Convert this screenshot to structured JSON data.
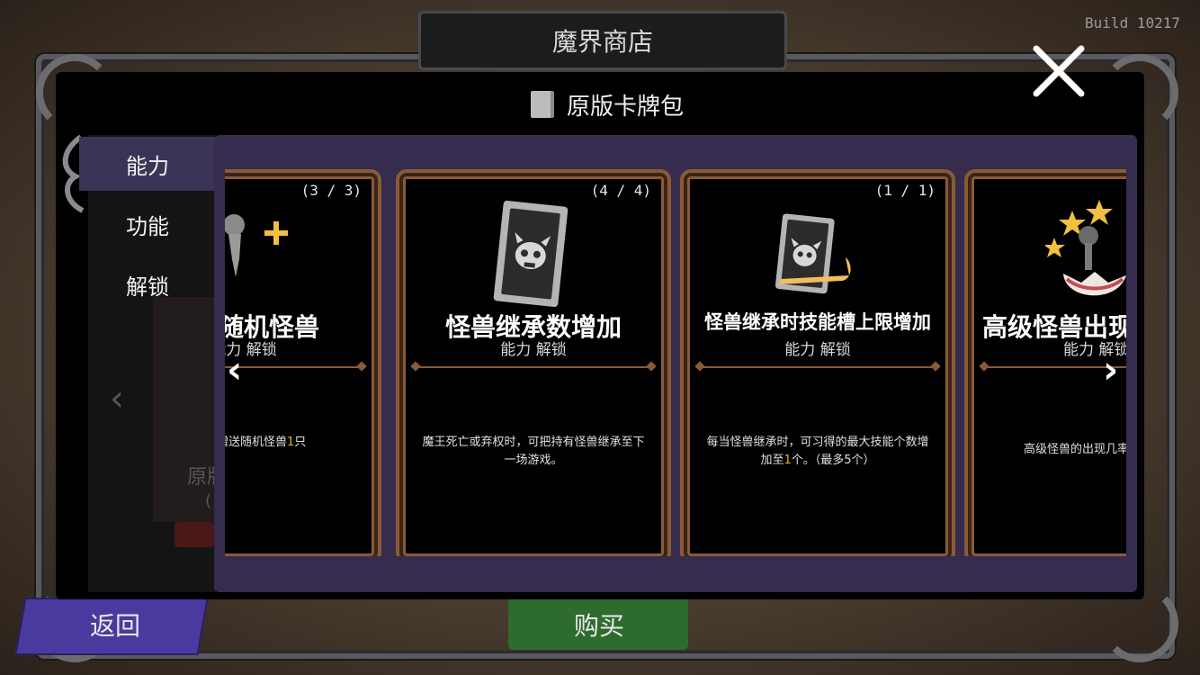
{
  "header": {
    "title": "魔界商店",
    "build": "Build 10217"
  },
  "dialog": {
    "title": "原版卡牌包"
  },
  "tabs": [
    {
      "label": "能力",
      "active": true
    },
    {
      "label": "功能",
      "active": false
    },
    {
      "label": "解锁",
      "active": false
    }
  ],
  "background": {
    "back_label": "返回",
    "buy_label": "购买",
    "ghost_title": "原版",
    "ghost_sub": "("
  },
  "cards": [
    {
      "count": "(3 / 3)",
      "title": "获得随机怪兽",
      "sub": "能力 解锁",
      "desc_a": "时，将赠送随机怪兽",
      "desc_hl": "1",
      "desc_b": "只",
      "desc_c": "。"
    },
    {
      "count": "(4 / 4)",
      "title": "怪兽继承数增加",
      "sub": "能力 解锁",
      "desc_a": "魔王死亡或弃权时，可把持有怪兽继承至下一场游戏。"
    },
    {
      "count": "(1 / 1)",
      "title": "怪兽继承时技能槽上限增加",
      "sub": "能力 解锁",
      "desc_a": "每当怪兽继承时，可习得的最大技能个数增加至",
      "desc_hl": "1",
      "desc_b": "个。（最多5个）"
    },
    {
      "count": "",
      "title": "高级怪兽出现几率",
      "sub": "能力 解锁",
      "desc_a": "高级怪兽的出现几率"
    }
  ],
  "icons": {
    "close": "close-icon",
    "prev": "chevron-left-icon",
    "next": "chevron-right-icon",
    "book": "book-icon"
  },
  "colors": {
    "panel": "#352c4e",
    "card_border": "#8a5a38",
    "highlight": "#f0b800",
    "back_button": "#4a3aa0",
    "buy_button": "#2e6b2e"
  }
}
